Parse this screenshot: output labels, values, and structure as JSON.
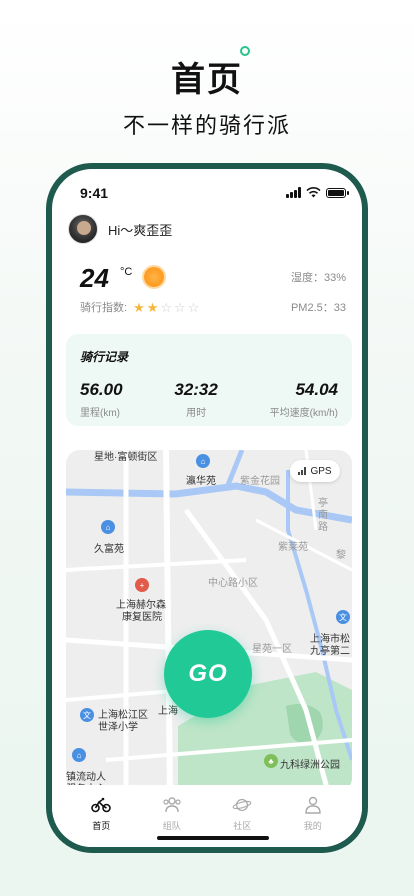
{
  "promo": {
    "title": "首页",
    "subtitle": "不一样的骑行派"
  },
  "status_bar": {
    "time": "9:41"
  },
  "user": {
    "greeting": "Hi～爽歪歪"
  },
  "weather": {
    "temperature": "24",
    "unit": "°C",
    "icon": "sun-icon",
    "humidity_label": "湿度：33%",
    "pm25_label": "PM2.5：33",
    "ride_index_label": "骑行指数:",
    "ride_index_stars": 2,
    "ride_index_max": 5
  },
  "ride_record": {
    "title": "骑行记录",
    "stats": [
      {
        "value": "56.00",
        "label": "里程(km)"
      },
      {
        "value": "32:32",
        "label": "用时"
      },
      {
        "value": "54.04",
        "label": "平均速度(km/h)"
      }
    ]
  },
  "map": {
    "gps_label": "GPS",
    "go_label": "GO",
    "labels": [
      "星地·富顿街区",
      "瀛华苑",
      "紫金花园",
      "亭",
      "南",
      "路",
      "紫莱苑",
      "黎",
      "久富苑",
      "中心路小区",
      "上海赫尔森",
      "康复医院",
      "上海市松",
      "九亭第二",
      "星苑一区",
      "上海松江区",
      "世泽小学",
      "上海",
      "九科绿洲公园",
      "镇流动人",
      "服务中心"
    ]
  },
  "tabbar": {
    "tabs": [
      {
        "label": "首页",
        "icon": "bike-icon",
        "active": true
      },
      {
        "label": "组队",
        "icon": "team-icon",
        "active": false
      },
      {
        "label": "社区",
        "icon": "planet-icon",
        "active": false
      },
      {
        "label": "我的",
        "icon": "user-icon",
        "active": false
      }
    ]
  },
  "colors": {
    "accent": "#21c997",
    "phone_frame": "#1e5a4d",
    "record_bg": "#eef8f5",
    "star_on": "#f5b63e"
  }
}
